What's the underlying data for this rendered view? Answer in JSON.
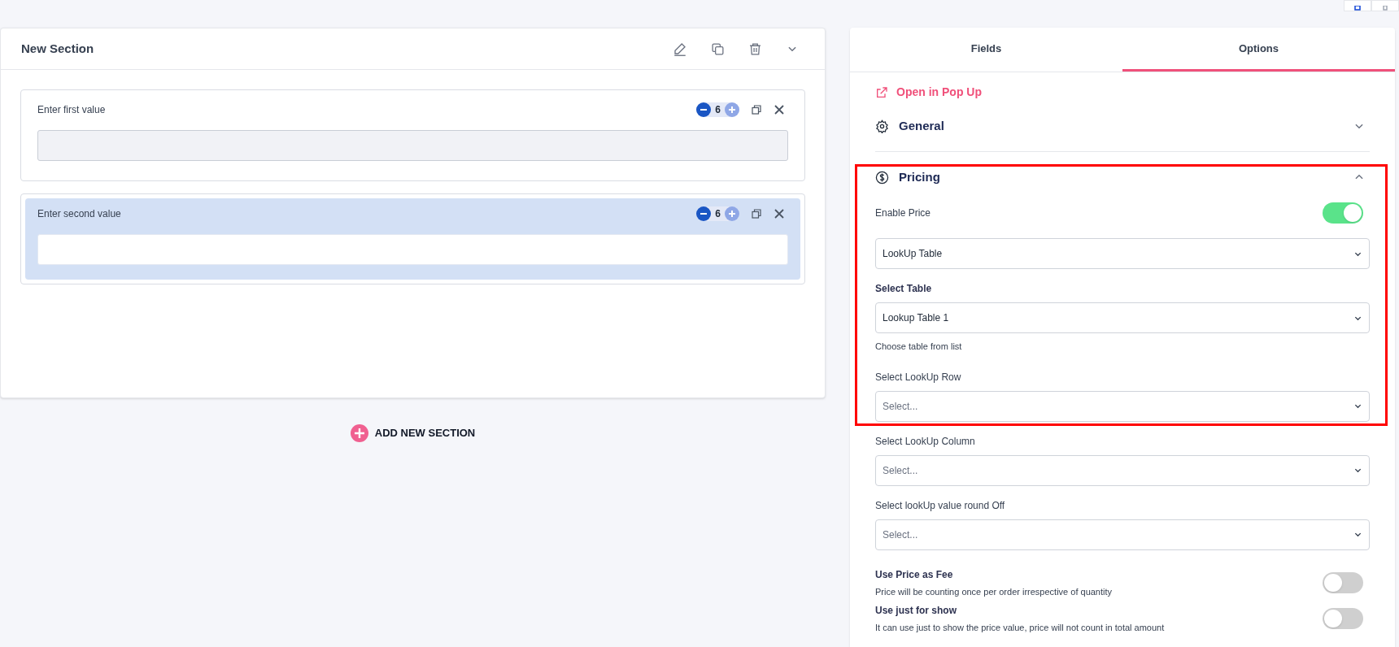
{
  "section": {
    "title": "New Section"
  },
  "fields": [
    {
      "label": "Enter first value",
      "count": "6",
      "selected": false,
      "disabled": true
    },
    {
      "label": "Enter second value",
      "count": "6",
      "selected": true,
      "disabled": false
    }
  ],
  "add_section": "ADD NEW SECTION",
  "tabs": [
    {
      "label": "Fields",
      "selected": false
    },
    {
      "label": "Options",
      "selected": true
    }
  ],
  "popup_link": "Open in Pop Up",
  "accordions": [
    {
      "title": "General",
      "kind": "gear",
      "expanded": false
    },
    {
      "title": "Pricing",
      "kind": "dollar",
      "expanded": true,
      "items": [
        {
          "kind": "toggle",
          "label": "Enable Price",
          "on": true
        },
        {
          "kind": "select",
          "value": "LookUp Table"
        },
        {
          "kind": "select",
          "label": "Select Table",
          "strong": true,
          "value": "Lookup Table 1",
          "help": "Choose table from list"
        },
        {
          "kind": "select",
          "label": "Select LookUp Row",
          "strong": false,
          "placeholder": "Select..."
        },
        {
          "kind": "select",
          "label": "Select LookUp Column",
          "strong": false,
          "placeholder": "Select..."
        },
        {
          "kind": "select",
          "label": "Select lookUp value round Off",
          "strong": false,
          "placeholder": "Select..."
        },
        {
          "kind": "toggle",
          "label": "Use Price as Fee",
          "description": "Price will be counting once per order irrespective of quantity",
          "on": false
        },
        {
          "kind": "toggle",
          "label": "Use just for show",
          "description": "It can use just to show the price value, price will not count in total amount",
          "on": false
        }
      ]
    }
  ]
}
